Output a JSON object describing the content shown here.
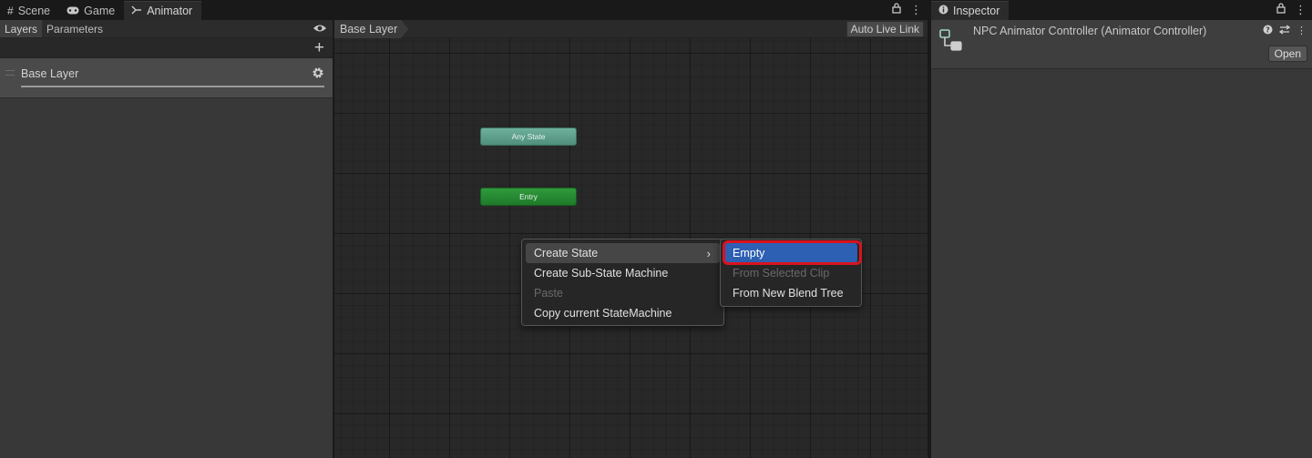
{
  "tabs": {
    "scene": "Scene",
    "game": "Game",
    "animator": "Animator",
    "inspector": "Inspector"
  },
  "layers_panel": {
    "tab_layers": "Layers",
    "tab_parameters": "Parameters",
    "add_label": "+",
    "layer_name": "Base Layer"
  },
  "graph": {
    "breadcrumb": "Base Layer",
    "auto_live_link": "Auto Live Link",
    "states": {
      "any_state": "Any State",
      "entry": "Entry"
    }
  },
  "context_menu": {
    "items": [
      "Create State",
      "Create Sub-State Machine",
      "Paste",
      "Copy current StateMachine"
    ]
  },
  "submenu": {
    "items": [
      "Empty",
      "From Selected Clip",
      "From New Blend Tree"
    ]
  },
  "inspector": {
    "title": "NPC Animator Controller (Animator Controller)",
    "open_button": "Open"
  },
  "colors": {
    "menu_selected": "#2d5fb2",
    "highlight_ring": "#d9131e",
    "any_state": "#5fa08c",
    "entry": "#268a33"
  }
}
